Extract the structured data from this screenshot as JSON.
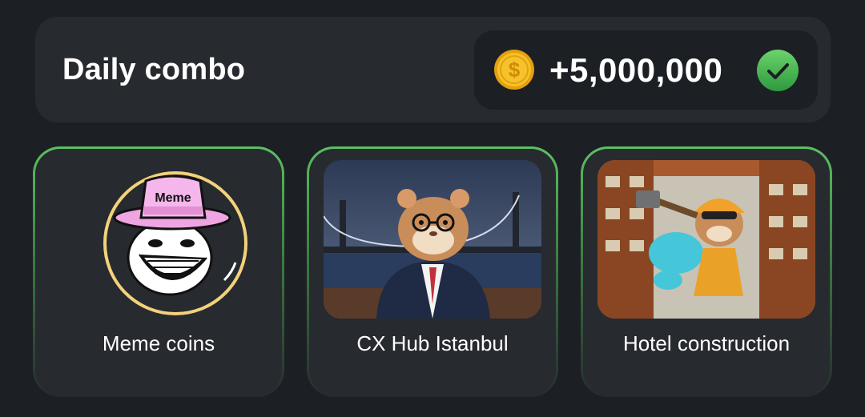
{
  "header": {
    "title": "Daily combo",
    "reward_amount": "+5,000,000",
    "coin_icon": "dollar-coin-icon",
    "coin_symbol": "$",
    "status_icon": "check-icon"
  },
  "cards": [
    {
      "label": "Meme coins",
      "image_text": "Meme",
      "image": "meme-hat-trollface-illustration"
    },
    {
      "label": "CX Hub Istanbul",
      "image": "hamster-business-suit-bridge-illustration"
    },
    {
      "label": "Hotel construction",
      "image": "hamster-builder-hotel-pool-illustration"
    }
  ],
  "colors": {
    "background": "#1c1f24",
    "panel": "#272a2f",
    "accent_green": "#5bc160",
    "coin_gold": "#f2b81e"
  }
}
